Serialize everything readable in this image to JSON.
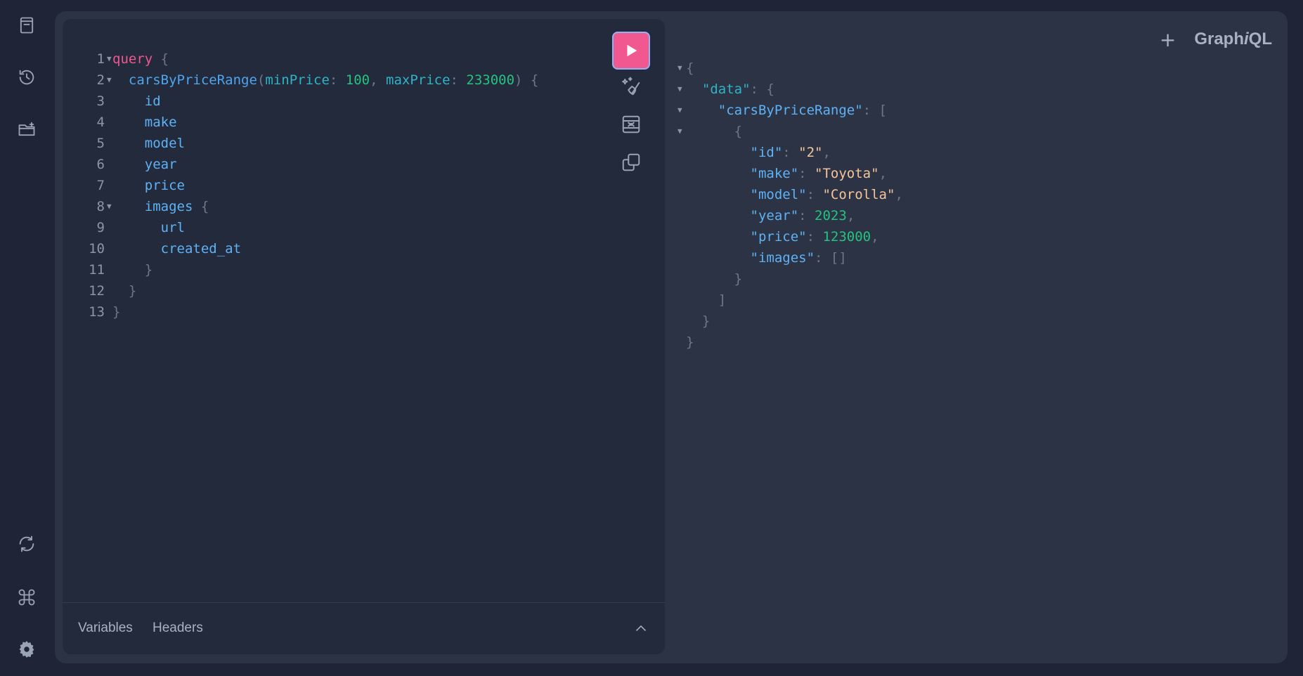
{
  "app": {
    "logo_prefix": "Graph",
    "logo_italic": "i",
    "logo_suffix": "QL",
    "new_tab_label": "+"
  },
  "sidebar": {
    "top": [
      {
        "icon": "docs-icon"
      },
      {
        "icon": "history-icon"
      },
      {
        "icon": "folder-add-icon"
      }
    ],
    "bottom": [
      {
        "icon": "refresh-icon"
      },
      {
        "icon": "command-icon"
      },
      {
        "icon": "settings-icon"
      }
    ]
  },
  "editor": {
    "line_numbers": [
      "1",
      "2",
      "3",
      "4",
      "5",
      "6",
      "7",
      "8",
      "9",
      "10",
      "11",
      "12",
      "13"
    ],
    "query_keyword": "query",
    "field": "carsByPriceRange",
    "arg1_name": "minPrice",
    "arg1_value": "100",
    "arg2_name": "maxPrice",
    "arg2_value": "233000",
    "fields": [
      "id",
      "make",
      "model",
      "year",
      "price",
      "images"
    ],
    "image_fields": [
      "url",
      "created_at"
    ]
  },
  "footer": {
    "tabs": [
      "Variables",
      "Headers"
    ]
  },
  "result": {
    "data_key": "\"data\"",
    "list_key": "\"carsByPriceRange\"",
    "id_key": "\"id\"",
    "id_value": "\"2\"",
    "make_key": "\"make\"",
    "make_value": "\"Toyota\"",
    "model_key": "\"model\"",
    "model_value": "\"Corolla\"",
    "year_key": "\"year\"",
    "year_value": "2023",
    "price_key": "\"price\"",
    "price_value": "123000",
    "images_key": "\"images\"",
    "images_value": "[]"
  },
  "colors": {
    "accent": "#f0588f",
    "background": "#1f2536",
    "panel": "#2b3344",
    "editor": "#222a3b"
  }
}
